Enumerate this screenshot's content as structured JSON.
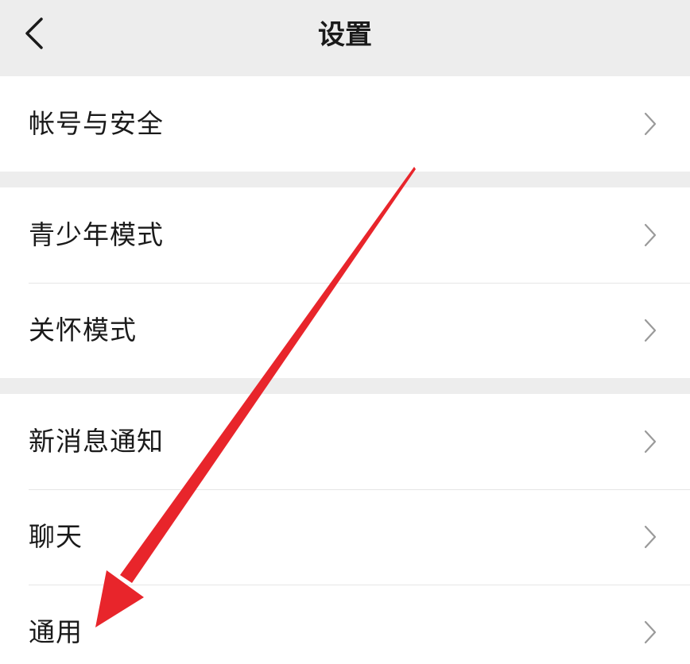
{
  "header": {
    "title": "设置",
    "back_icon": "chevron-left-icon"
  },
  "groups": [
    {
      "items": [
        {
          "label": "帐号与安全"
        }
      ]
    },
    {
      "items": [
        {
          "label": "青少年模式"
        },
        {
          "label": "关怀模式"
        }
      ]
    },
    {
      "items": [
        {
          "label": "新消息通知"
        },
        {
          "label": "聊天"
        },
        {
          "label": "通用"
        }
      ]
    }
  ],
  "icons": {
    "row_chevron": "chevron-right-icon",
    "annotation": "red-arrow-icon"
  },
  "colors": {
    "background": "#ededed",
    "row_background": "#ffffff",
    "text": "#1a1a1a",
    "chevron": "#9a9a9a",
    "annotation_arrow": "#e8252b"
  }
}
